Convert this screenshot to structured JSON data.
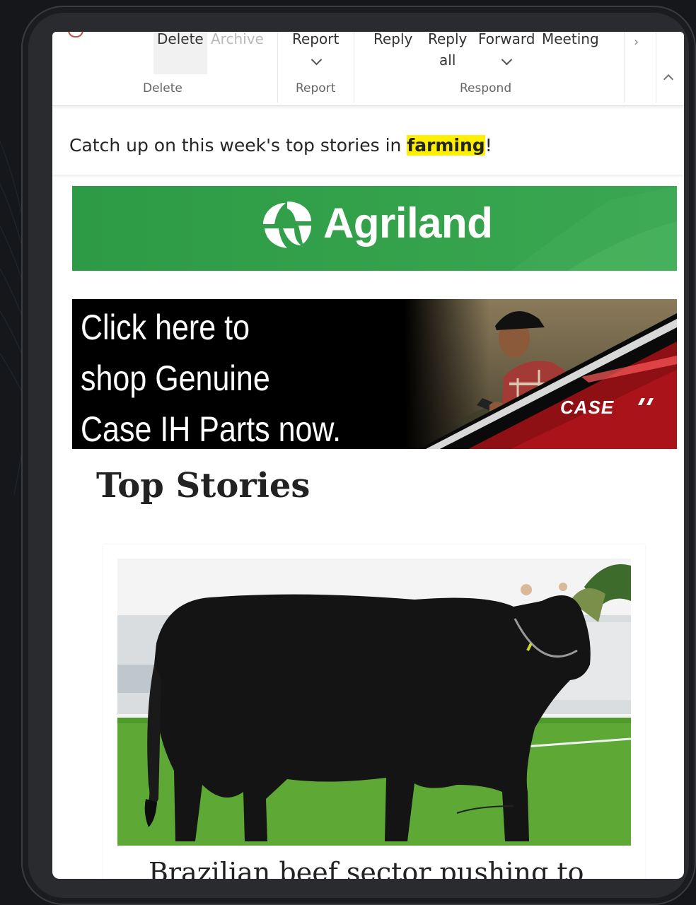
{
  "ribbon": {
    "delete_label": "Delete",
    "archive_label": "Archive",
    "delete_group": "Delete",
    "report_label": "Report",
    "report_group": "Report",
    "reply_label": "Reply",
    "reply_all_line1": "Reply",
    "reply_all_line2": "all",
    "forward_label": "Forward",
    "meeting_label": "Meeting",
    "respond_group": "Respond"
  },
  "email": {
    "preheader_prefix": "Catch up on this week's top stories in ",
    "preheader_highlight": "farming",
    "preheader_suffix": "!",
    "brand_name": "Agriland",
    "ad_line1": "Click here to",
    "ad_line2": "shop Genuine",
    "ad_line3": "Case IH Parts now.",
    "ad_logo": "CASE",
    "section_title": "Top Stories",
    "story_headline": "Brazilian beef sector pushing to"
  },
  "colors": {
    "brand_green": "#35a24c",
    "highlight_yellow": "#fff000",
    "case_red": "#c0141e"
  }
}
